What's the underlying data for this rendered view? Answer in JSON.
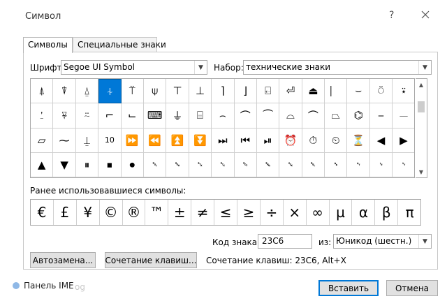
{
  "window": {
    "title": "Символ",
    "help_glyph": "?",
    "close_glyph": "✕"
  },
  "tabs": [
    {
      "label": "Символы",
      "active": true
    },
    {
      "label": "Специальные знаки",
      "active": false
    }
  ],
  "font_row": {
    "font_label": "Шрифт:",
    "font_value": "Segoe UI Symbol",
    "subset_label": "Набор:",
    "subset_value": "технические знаки"
  },
  "symbol_grid": {
    "rows": [
      [
        "⍋",
        "⍒",
        "⍙",
        "⍭",
        "⍡",
        "⍦",
        "⊤",
        "⊥",
        "⌉",
        "⌋",
        "⍇",
        "⏎",
        "⏏",
        "⎸",
        "⌣",
        "⍥",
        "⍣"
      ],
      [
        "⍘",
        "⍫",
        "⍨",
        "⌐",
        "⌙",
        "⌨",
        "⏚",
        "⌸",
        "⌢",
        "⌒",
        "⏜",
        "⌓",
        "⌒",
        "⏢",
        "⌬",
        "⎯",
        "⏤"
      ],
      [
        "▱",
        "⁓",
        "⍊",
        "10",
        "⏩",
        "⏪",
        "⏫",
        "⏬",
        "⏭",
        "⏮",
        "⏯",
        "⏰",
        "⏱",
        "⏲",
        "⏳",
        "◀",
        "▶"
      ],
      [
        "▲",
        "▼",
        "⏸",
        "⏹",
        "⏺",
        "␀",
        "␁",
        "␂",
        "␃",
        "␄",
        "␅",
        "␆",
        "␇",
        "␈",
        "␉",
        "␊",
        "␋"
      ]
    ],
    "selected_row": 0,
    "selected_col": 3
  },
  "recent": {
    "label": "Ранее использовавшиеся символы:",
    "symbols": [
      "€",
      "£",
      "¥",
      "©",
      "®",
      "™",
      "±",
      "≠",
      "≤",
      "≥",
      "÷",
      "×",
      "∞",
      "µ",
      "α",
      "β",
      "π"
    ]
  },
  "char_code": {
    "label": "Код знака:",
    "value": "23C6",
    "from_label": "из:",
    "from_value": "Юникод (шестн.)"
  },
  "buttons": {
    "autocorrect": "Автозамена...",
    "shortcut_key": "Сочетание клавиш...",
    "shortcut_info": "Сочетание клавиш: 23C6, Alt+X",
    "insert": "Вставить",
    "cancel": "Отмена"
  },
  "ime": {
    "label": "Панель IME",
    "watermark": "og"
  },
  "colors": {
    "selection": "#0078d7",
    "button_face": "#e1e1e1"
  }
}
